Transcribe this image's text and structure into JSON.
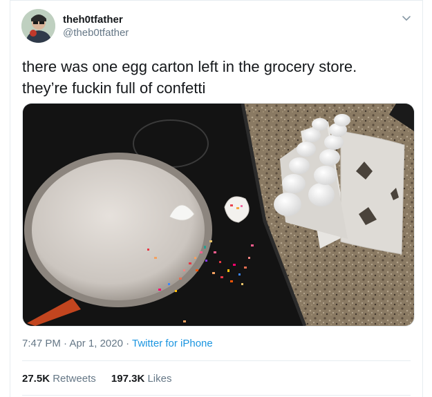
{
  "author": {
    "display_name": "theh0tfather",
    "handle": "@theb0tfather"
  },
  "tweet": {
    "text_line1": "there was one egg carton left in the grocery store.",
    "text_line2": "they’re fuckin full of confetti"
  },
  "meta": {
    "time": "7:47 PM",
    "separator1": " · ",
    "date": "Apr 1, 2020",
    "separator2": " · ",
    "source": "Twitter for iPhone"
  },
  "stats": {
    "retweets_count": "27.5K",
    "retweets_label": "Retweets",
    "likes_count": "197.3K",
    "likes_label": "Likes"
  },
  "icons": {
    "menu": "chevron-down-icon"
  },
  "colors": {
    "link": "#1b95e0",
    "secondary_text": "#657786",
    "border": "#e6ecf0"
  }
}
